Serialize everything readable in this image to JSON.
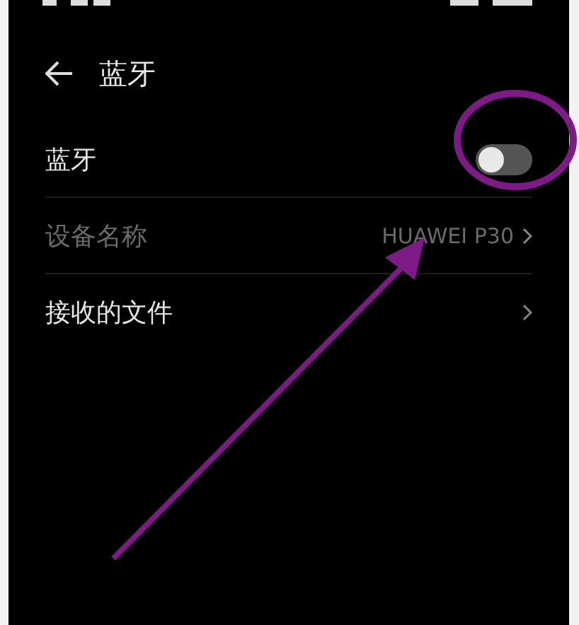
{
  "header": {
    "title": "蓝牙"
  },
  "settings": [
    {
      "kind": "toggle",
      "label": "蓝牙",
      "on": false,
      "disabled": false
    },
    {
      "kind": "link",
      "label": "设备名称",
      "value": "HUAWEI P30",
      "disabled": true
    },
    {
      "kind": "link",
      "label": "接收的文件",
      "disabled": false
    }
  ]
}
